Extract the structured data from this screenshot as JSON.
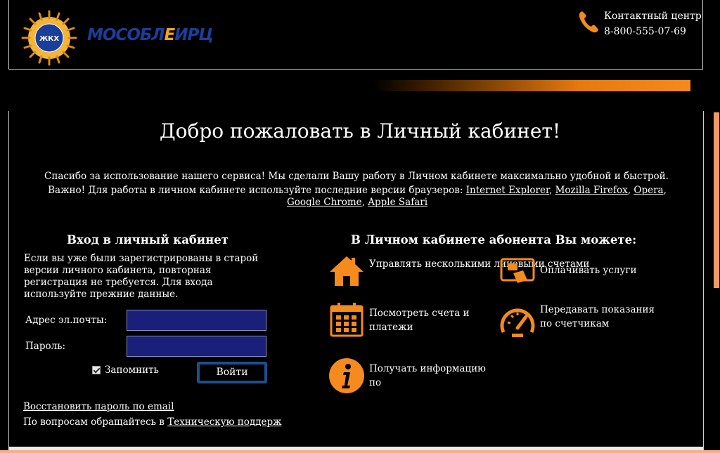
{
  "header": {
    "logo_text_left": "МОСОБЛ",
    "logo_text_mid": "Е",
    "logo_text_right": "ИРЦ",
    "logo_badge": "ЖКХ",
    "contact_title": "Контактный центр",
    "contact_phone": "8-800-555-07-69"
  },
  "welcome": {
    "title": "Добро пожаловать в Личный кабинет!",
    "intro_line1": "Спасибо за использование нашего сервиса! Мы сделали Вашу работу в Личном кабинете максимально удобной и быстрой.",
    "intro_line2_prefix": "Важно! Для работы в личном кабинете используйте последние версии браузеров:",
    "browsers": {
      "ie": "Internet Explorer",
      "firefox": "Mozilla Firefox",
      "opera": "Opera",
      "chrome": "Google Chrome",
      "safari": "Apple Safari"
    }
  },
  "login": {
    "title": "Вход в личный кабинет",
    "description": "Если вы уже были зарегистрированы в старой версии личного кабинета, повторная регистрация не требуется. Для входа используйте прежние данные.",
    "email_label": "Адрес эл.почты:",
    "email_value": "",
    "password_label": "Пароль:",
    "password_value": "",
    "remember_label": "Запомнить",
    "submit_label": "Войти",
    "restore_link": "Восстановить пароль по email",
    "support_prefix": "По вопросам обращайтесь в",
    "support_link": "Техническую поддерж"
  },
  "features": {
    "title": "В Личном кабинете абонента Вы можете:",
    "items": [
      {
        "icon": "house-icon",
        "label": "Управлять несколькими лицевыми счетами"
      },
      {
        "icon": "card-payment-icon",
        "label": "Оплачивать услуги"
      },
      {
        "icon": "calendar-icon",
        "label": "Посмотреть счета и платежи"
      },
      {
        "icon": "gauge-icon",
        "label": "Передавать показания по счетчикам"
      },
      {
        "icon": "info-icon",
        "label": "Получать информацию по"
      }
    ]
  },
  "colors": {
    "accent_orange": "#f58a1e",
    "field_bg": "#1a1f7a",
    "button_border": "#1d4f8f",
    "logo_blue": "#1a3e9a"
  }
}
